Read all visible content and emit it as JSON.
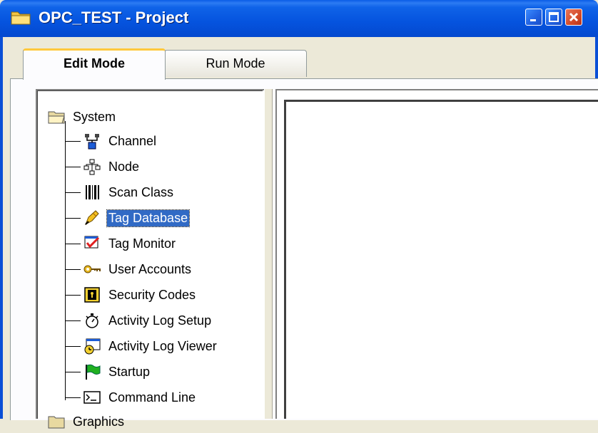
{
  "window": {
    "title": "OPC_TEST - Project",
    "icon": "folder-icon",
    "controls": [
      "minimize-icon",
      "maximize-icon",
      "close-icon"
    ]
  },
  "tabs": [
    {
      "label": "Edit Mode",
      "active": true
    },
    {
      "label": "Run Mode",
      "active": false
    }
  ],
  "tree": {
    "root": {
      "label": "System",
      "icon": "open-folder-icon"
    },
    "items": [
      {
        "label": "Channel",
        "icon": "channel-icon"
      },
      {
        "label": "Node",
        "icon": "node-network-icon"
      },
      {
        "label": "Scan Class",
        "icon": "barcode-icon"
      },
      {
        "label": "Tag Database",
        "icon": "pen-icon",
        "selected": true
      },
      {
        "label": "Tag Monitor",
        "icon": "monitor-check-icon"
      },
      {
        "label": "User Accounts",
        "icon": "key-icon"
      },
      {
        "label": "Security Codes",
        "icon": "lock-icon"
      },
      {
        "label": "Activity Log Setup",
        "icon": "stopwatch-icon"
      },
      {
        "label": "Activity Log Viewer",
        "icon": "log-viewer-icon"
      },
      {
        "label": "Startup",
        "icon": "green-flag-icon"
      },
      {
        "label": "Command Line",
        "icon": "command-prompt-icon"
      }
    ],
    "next_root_partial": {
      "label": "Graphics",
      "icon": "folder-icon"
    }
  },
  "colors": {
    "titlebar": "#0553DE",
    "selection": "#316AC5",
    "tab_highlight": "#FFC83C",
    "window_bg": "#ECE9D8"
  }
}
